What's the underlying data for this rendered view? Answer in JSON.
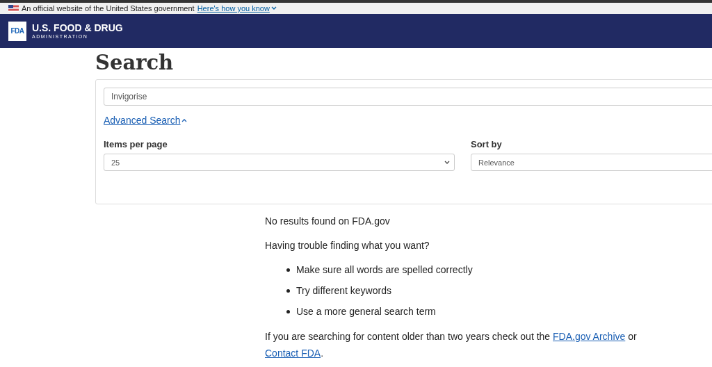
{
  "gov_banner": {
    "text": "An official website of the United States government",
    "link": "Here's how you know"
  },
  "header": {
    "logo": "FDA",
    "title": "U.S. FOOD & DRUG",
    "subtitle": "ADMINISTRATION"
  },
  "page_title": "Search",
  "search": {
    "value": "Invigorise",
    "advanced_link": "Advanced Search",
    "advanced_expanded": true,
    "fields": [
      {
        "label": "Items per page",
        "value": "25"
      },
      {
        "label": "Sort by",
        "value": "Relevance"
      }
    ]
  },
  "results": {
    "message": "No results found on FDA.gov",
    "help_heading": "Having trouble finding what you want?",
    "tips": [
      "Make sure all words are spelled correctly",
      "Try different keywords",
      "Use a more general search term"
    ],
    "footer_text": "If you are searching for content older than two years check out the",
    "archive_link": "FDA.gov Archive",
    "joiner": "or",
    "contact_link": "Contact FDA",
    "end": "."
  }
}
